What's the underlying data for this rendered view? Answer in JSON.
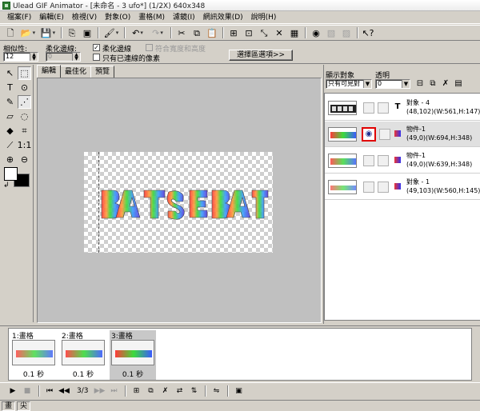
{
  "window": {
    "title": "Ulead GIF Animator - [未命名 - 3 ufo*] (1/2X) 640x348"
  },
  "menu": [
    "檔案(F)",
    "編輯(E)",
    "檢視(V)",
    "對象(O)",
    "畫格(M)",
    "濾鏡(I)",
    "網訊效果(D)",
    "說明(H)"
  ],
  "options": {
    "tolerance_label": "相似性:",
    "tolerance_value": "12",
    "feather_label": "柔化邊線:",
    "feather_value": "0",
    "antialias_label": "柔化邊線",
    "antialias_checked": true,
    "fit_label": "符合寬度和高度",
    "fit_checked": false,
    "contiguous_label": "只有已連線的像素",
    "contiguous_checked": false,
    "select_options_button": "選擇區選項>>"
  },
  "tabs": [
    "編輯",
    "最佳化",
    "預覽"
  ],
  "active_tab": 0,
  "right_panel": {
    "show_label": "顯示對象",
    "show_value": "只有可見對",
    "opacity_label": "透明",
    "opacity_value": "0"
  },
  "layers": [
    {
      "name": "對象 - 4",
      "info": "(48,102)(W:561,H:147)",
      "type_icon": "T",
      "selected": false,
      "eye": false
    },
    {
      "name": "物件-1",
      "info": "(49,0)(W:694,H:348)",
      "type_icon": "",
      "selected": true,
      "eye": true
    },
    {
      "name": "物件-1",
      "info": "(49,0)(W:639,H:348)",
      "type_icon": "",
      "selected": false,
      "eye": false
    },
    {
      "name": "對象 - 1",
      "info": "(49,103)(W:560,H:145)",
      "type_icon": "",
      "selected": false,
      "eye": false
    }
  ],
  "frames": [
    {
      "title": "1:畫格",
      "delay": "0.1 秒",
      "selected": false
    },
    {
      "title": "2:畫格",
      "delay": "0.1 秒",
      "selected": false
    },
    {
      "title": "3:畫格",
      "delay": "0.1 秒",
      "selected": true
    }
  ],
  "playback": {
    "counter": "3/3"
  },
  "status": {
    "cells": [
      "畫",
      "尖"
    ]
  },
  "colors": {
    "foreground": "#ffffff",
    "background": "#000000",
    "highlight": "#e00000"
  }
}
